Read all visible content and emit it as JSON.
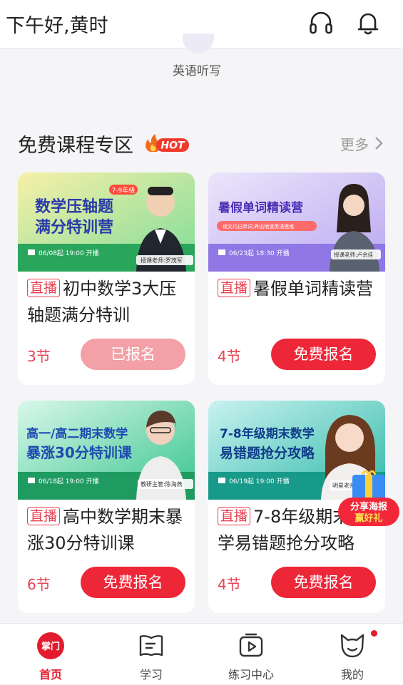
{
  "header": {
    "greeting": "下午好,黄时"
  },
  "dictation": {
    "label": "英语听写"
  },
  "section": {
    "title": "免费课程专区",
    "hot_badge": "HOT",
    "more_label": "更多"
  },
  "courses": [
    {
      "banner_line1": "数学压轴题",
      "banner_line2": "满分特训营",
      "grade_tag": "7-9年级",
      "banner_date": "06/08起 19:00 开播",
      "banner_teacher": "授课老师:罗茂军",
      "tag": "直播",
      "title": "初中数学3大压轴题满分特训",
      "lessons": "3节",
      "button": "已报名"
    },
    {
      "banner_line1": "暑假单词精读营",
      "banner_line2": "读文巧记单词,养出地道英语思维",
      "banner_date": "06/23起 18:30 开播",
      "banner_teacher": "授课老师:卢余佳",
      "tag": "直播",
      "title": "暑假单词精读营",
      "lessons": "4节",
      "button": "免费报名"
    },
    {
      "banner_line1": "高一/高二期末数学",
      "banner_line2": "暴涨30分特训课",
      "banner_date": "06/18起 19:00 开播",
      "banner_teacher": "教研主管:陈海燕",
      "tag": "直播",
      "title": "高中数学期末暴涨30分特训课",
      "lessons": "6节",
      "button": "免费报名"
    },
    {
      "banner_line1": "7-8年级期末数学",
      "banner_line2": "易错题抢分攻略",
      "banner_date": "06/19起 19:00 开播",
      "banner_teacher": "明星老师",
      "tag": "直播",
      "title": "7-8年级期末数学易错题抢分攻略",
      "lessons": "4节",
      "button": "免费报名"
    }
  ],
  "share": {
    "line1": "分享海报",
    "line2": "赢好礼"
  },
  "tabbar": [
    {
      "label": "首页",
      "icon_text": "掌门"
    },
    {
      "label": "学习"
    },
    {
      "label": "练习中心"
    },
    {
      "label": "我的"
    }
  ],
  "colors": {
    "accent": "#ed2638",
    "accent_light": "#f3a0a6",
    "tag": "#e94152"
  }
}
